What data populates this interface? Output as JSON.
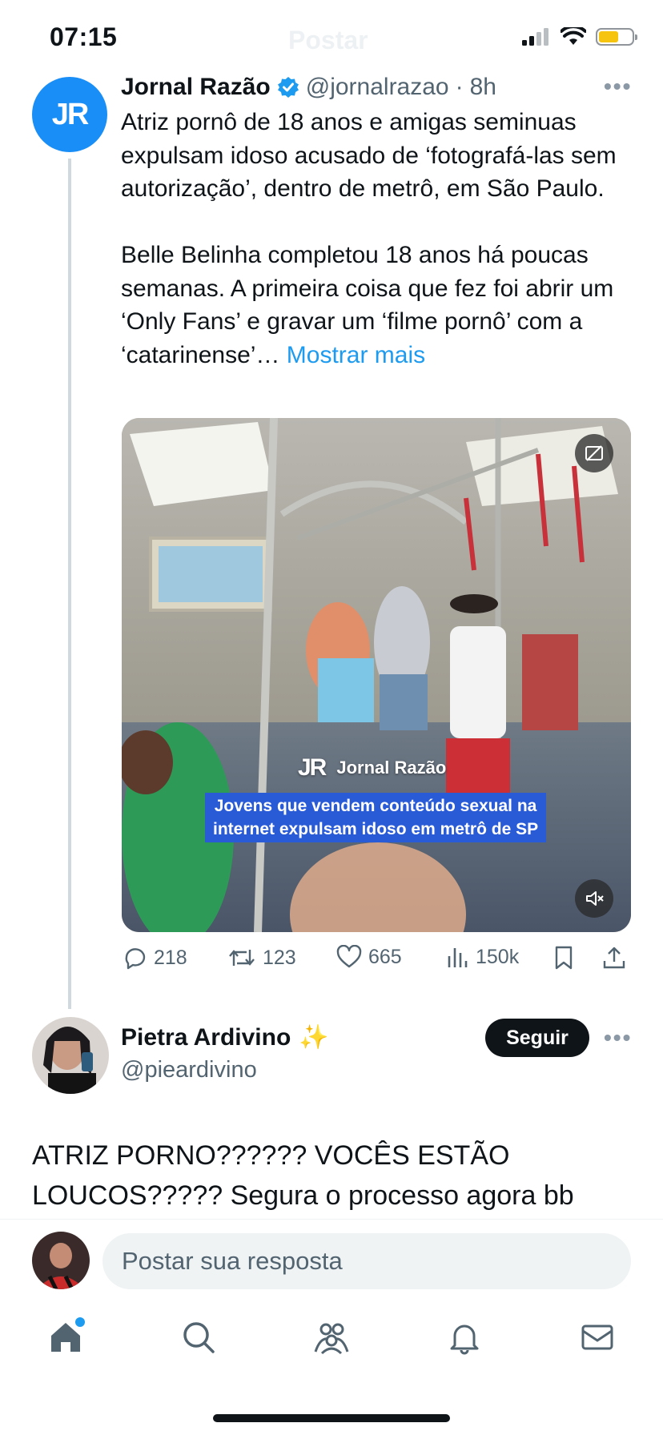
{
  "status_bar": {
    "time": "07:15",
    "header_ghost": "Postar",
    "icons": [
      "signal-icon",
      "wifi-icon",
      "battery-icon"
    ],
    "battery_level": 0.55
  },
  "tweet": {
    "avatar_initials": "JR",
    "author_name": "Jornal Razão",
    "verified": true,
    "handle": "@jornalrazao",
    "separator": "·",
    "time": "8h",
    "paragraph_1": "Atriz pornô de 18 anos e amigas seminuas expulsam idoso acusado de ‘fotografá-las sem autorização’, dentro de metrô, em São Paulo.",
    "paragraph_2": "Belle Belinha completou 18 anos há poucas semanas. A primeira coisa que fez foi abrir um ‘Only Fans’ e gravar um ‘filme pornô’ com a ‘catarinense’…",
    "show_more": "Mostrar mais",
    "media": {
      "brand_logo": "JR",
      "brand_name": "Jornal Razão",
      "caption_line_1": "Jovens que vendem conteúdo sexual na",
      "caption_line_2": "internet expulsam idoso em metrô de SP"
    },
    "actions": {
      "replies": "218",
      "reposts": "123",
      "likes": "665",
      "views": "150k"
    }
  },
  "reply": {
    "author_name": "Pietra Ardivino",
    "emoji": "✨",
    "handle": "@pieardivino",
    "follow_label": "Seguir",
    "text": "ATRIZ PORNO?????? VOCÊS ESTÃO LOUCOS????? Segura o processo agora bb"
  },
  "compose": {
    "placeholder": "Postar sua resposta"
  },
  "tab_bar": [
    "home-icon",
    "search-icon",
    "communities-icon",
    "notifications-icon",
    "messages-icon"
  ],
  "colors": {
    "accent": "#1d9bf0",
    "text": "#0f1419",
    "muted": "#536471",
    "brand_avatar": "#1a8ef7",
    "caption_bg": "#2a5bd7"
  }
}
